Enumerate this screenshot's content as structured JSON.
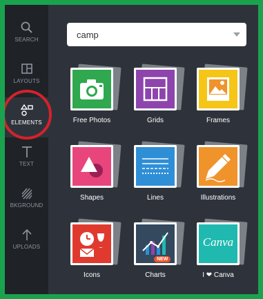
{
  "sidebar": {
    "items": [
      {
        "label": "SEARCH",
        "icon": "search-icon"
      },
      {
        "label": "LAYOUTS",
        "icon": "layouts-icon"
      },
      {
        "label": "ELEMENTS",
        "icon": "elements-icon"
      },
      {
        "label": "TEXT",
        "icon": "text-icon"
      },
      {
        "label": "BKGROUND",
        "icon": "background-icon"
      },
      {
        "label": "UPLOADS",
        "icon": "upload-arrow-icon"
      }
    ],
    "active_item": "ELEMENTS"
  },
  "search": {
    "value": "camp"
  },
  "categories": [
    {
      "label": "Free Photos",
      "icon": "camera-icon",
      "color": "#2fa84f"
    },
    {
      "label": "Grids",
      "icon": "grid-icon",
      "color": "#8e44ad"
    },
    {
      "label": "Frames",
      "icon": "frame-icon",
      "color": "#f5c518"
    },
    {
      "label": "Shapes",
      "icon": "shapes-icon",
      "color": "#e8457c"
    },
    {
      "label": "Lines",
      "icon": "lines-icon",
      "color": "#2f8fd6"
    },
    {
      "label": "Illustrations",
      "icon": "pencil-icon",
      "color": "#f0932b"
    },
    {
      "label": "Icons",
      "icon": "clock-glass-icon",
      "color": "#e03a2f"
    },
    {
      "label": "Charts",
      "icon": "chart-icon",
      "color": "#34495e",
      "badge": "NEW"
    },
    {
      "label": "I ❤ Canva",
      "icon": "canva-logo-icon",
      "color": "#20b9b0",
      "logo_text": "Canva"
    }
  ],
  "colors": {
    "frame_border": "#1aa34f",
    "panel": "#2e333b",
    "sidebar": "#1f2328",
    "highlight_ring": "#d4222b"
  }
}
